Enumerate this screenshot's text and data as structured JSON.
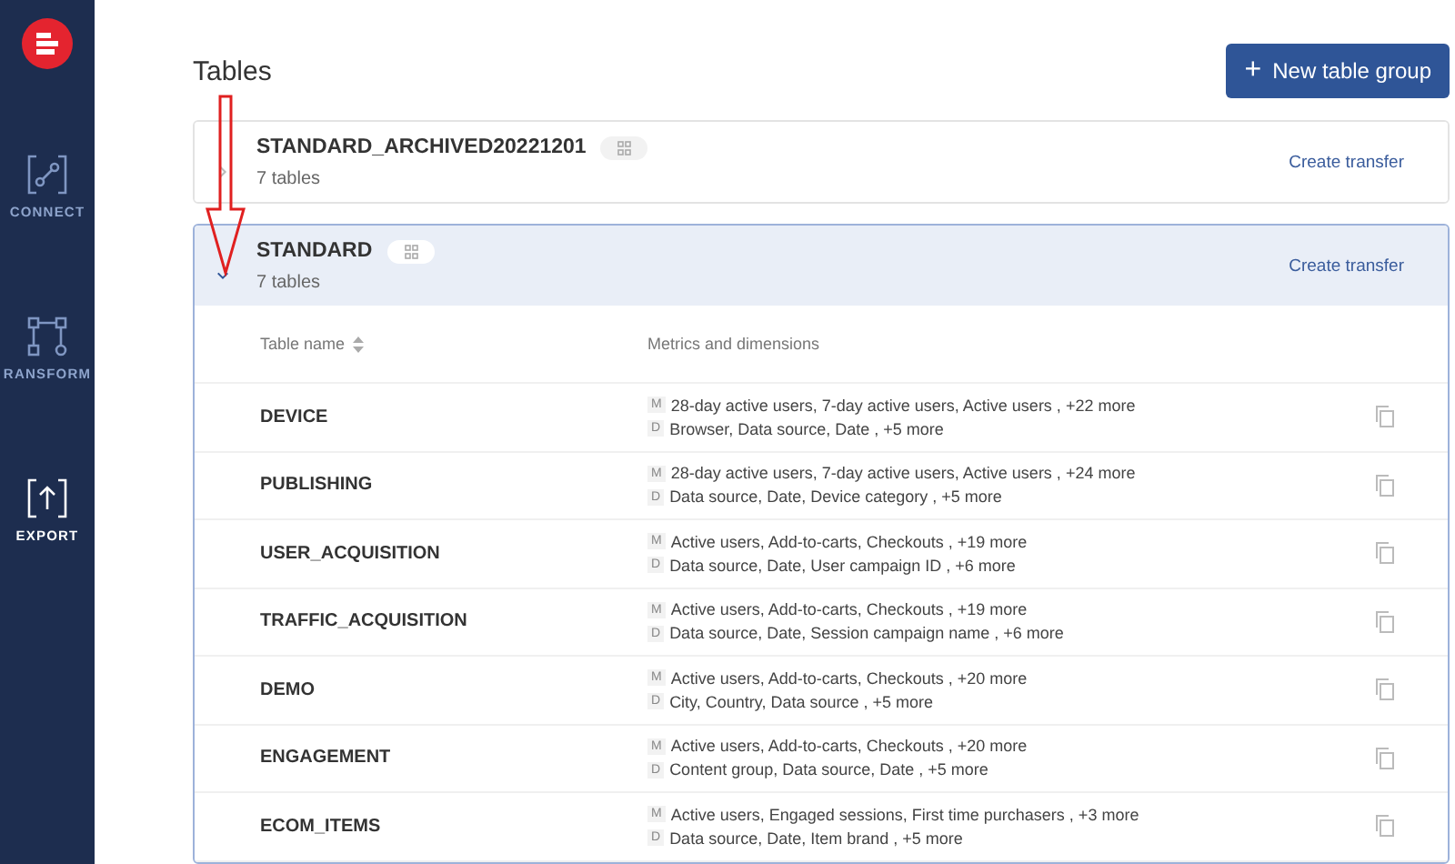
{
  "sidebar": {
    "items": [
      {
        "kind": "connect",
        "label": "CONNECT",
        "selected": false
      },
      {
        "kind": "transform",
        "label": "RANSFORM",
        "selected": false
      },
      {
        "kind": "export",
        "label": "EXPORT",
        "selected": true
      }
    ]
  },
  "page_title": "Tables",
  "new_button": {
    "icon": "+",
    "label": "New table group"
  },
  "groups": [
    {
      "name": "STANDARD_ARCHIVED20221201",
      "count": "7 tables",
      "expanded": false,
      "action": "Create transfer"
    },
    {
      "name": "STANDARD",
      "count": "7 tables",
      "expanded": true,
      "action": "Create transfer",
      "table": {
        "columns": [
          "Table name",
          "Metrics and dimensions"
        ],
        "rows": [
          {
            "metric_tag": "M",
            "dimension_tag": "D",
            "name": "DEVICE",
            "metrics": "28-day active users, 7-day active users, Active users , +22 more",
            "dimensions": "Browser, Data source, Date , +5 more"
          },
          {
            "metric_tag": "M",
            "dimension_tag": "D",
            "name": "PUBLISHING",
            "metrics": "28-day active users, 7-day active users, Active users , +24 more",
            "dimensions": "Data source, Date, Device category , +5 more"
          },
          {
            "metric_tag": "M",
            "dimension_tag": "D",
            "name": "USER_ACQUISITION",
            "metrics": "Active users, Add-to-carts, Checkouts , +19 more",
            "dimensions": "Data source, Date, User campaign ID , +6 more"
          },
          {
            "metric_tag": "M",
            "dimension_tag": "D",
            "name": "TRAFFIC_ACQUISITION",
            "metrics": "Active users, Add-to-carts, Checkouts , +19 more",
            "dimensions": "Data source, Date, Session campaign name , +6 more"
          },
          {
            "metric_tag": "M",
            "dimension_tag": "D",
            "name": "DEMO",
            "metrics": "Active users, Add-to-carts, Checkouts , +20 more",
            "dimensions": "City, Country, Data source , +5 more"
          },
          {
            "metric_tag": "M",
            "dimension_tag": "D",
            "name": "ENGAGEMENT",
            "metrics": "Active users, Add-to-carts, Checkouts , +20 more",
            "dimensions": "Content group, Data source, Date , +5 more"
          },
          {
            "metric_tag": "M",
            "dimension_tag": "D",
            "name": "ECOM_ITEMS",
            "metrics": "Active users, Engaged sessions, First time purchasers , +3 more",
            "dimensions": "Data source, Date, Item brand , +5 more"
          }
        ]
      }
    }
  ]
}
